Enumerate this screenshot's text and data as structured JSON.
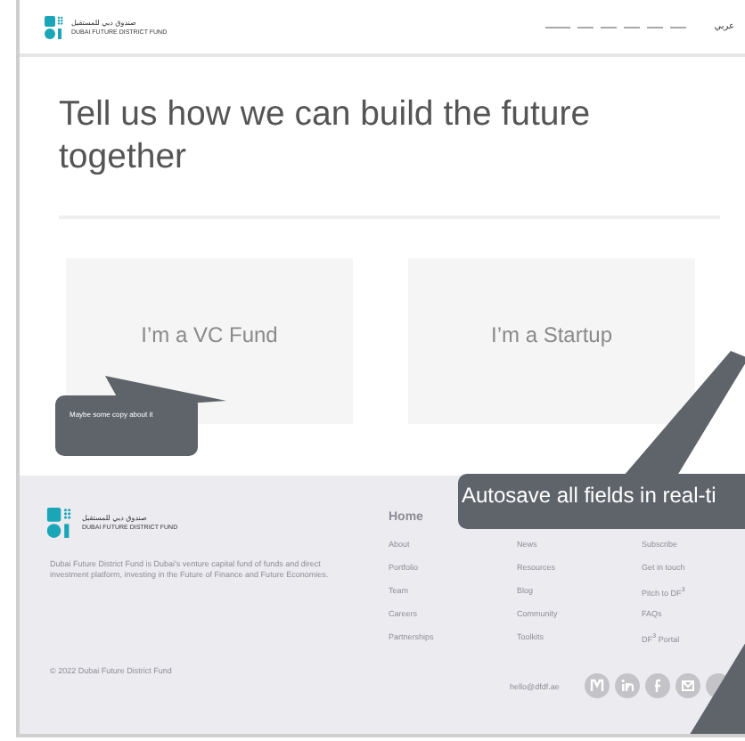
{
  "header": {
    "logo_arabic": "صندوق دبي للمستقبل",
    "logo_english": "DUBAI FUTURE DISTRICT FUND",
    "language_link": "عربي"
  },
  "heading": "Tell us how we can build the future together",
  "choices": [
    {
      "label": "I’m a VC Fund"
    },
    {
      "label": "I’m a Startup"
    }
  ],
  "notes": [
    {
      "kind": "small",
      "text": "Maybe some copy about it"
    },
    {
      "kind": "large",
      "text": "Autosave all fields in real-ti"
    }
  ],
  "footer": {
    "logo_arabic": "صندوق دبي للمستقبل",
    "logo_english": "DUBAI FUTURE DISTRICT FUND",
    "description": "Dubai Future District Fund is Dubai's venture capital fund of funds and direct investment platform, investing in the Future of Finance and Future Economies.",
    "home": "Home",
    "columns": [
      [
        "About",
        "Portfolio",
        "Team",
        "Careers",
        "Partnerships"
      ],
      [
        "News",
        "Resources",
        "Blog",
        "Community",
        "Toolkits"
      ],
      [
        "Subscribe",
        "Get in touch",
        "Pitch to DF$^{3}$",
        "FAQs",
        "DF$^{3}$ Portal"
      ]
    ],
    "copyright": "© 2022 Dubai Future District Fund",
    "email": "hello@dfdf.ae",
    "social": [
      {
        "kind": "m"
      },
      {
        "kind": "linkedin"
      },
      {
        "kind": "facebook"
      },
      {
        "kind": "mail"
      },
      {
        "kind": "other"
      }
    ]
  }
}
